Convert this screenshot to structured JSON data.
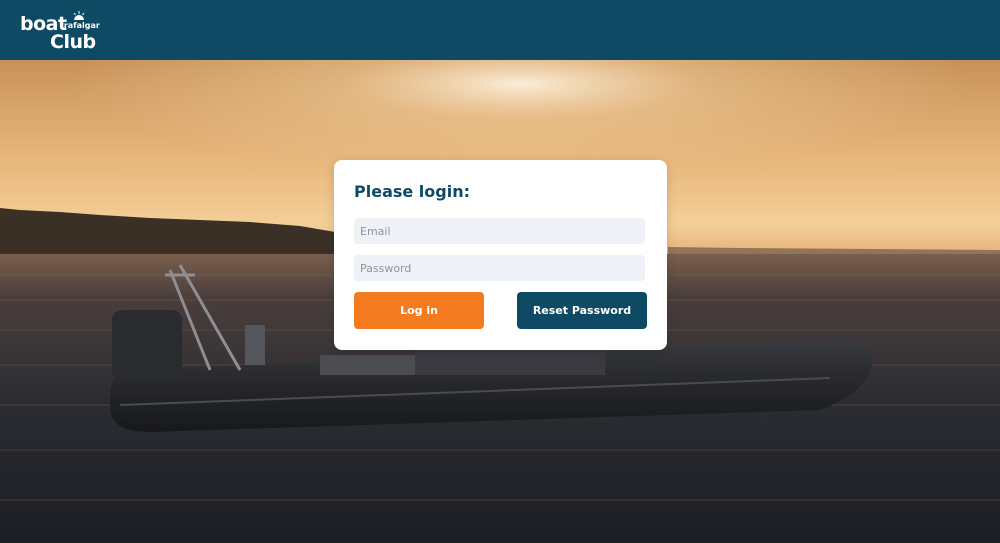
{
  "header": {
    "logo": {
      "line1": "boat",
      "line2": "Club",
      "tagline": "trafalgar"
    }
  },
  "login": {
    "title": "Please login:",
    "email_placeholder": "Email",
    "password_placeholder": "Password",
    "login_label": "Log in",
    "reset_label": "Reset Password"
  },
  "colors": {
    "brand": "#0e4a63",
    "accent": "#f47b20"
  }
}
